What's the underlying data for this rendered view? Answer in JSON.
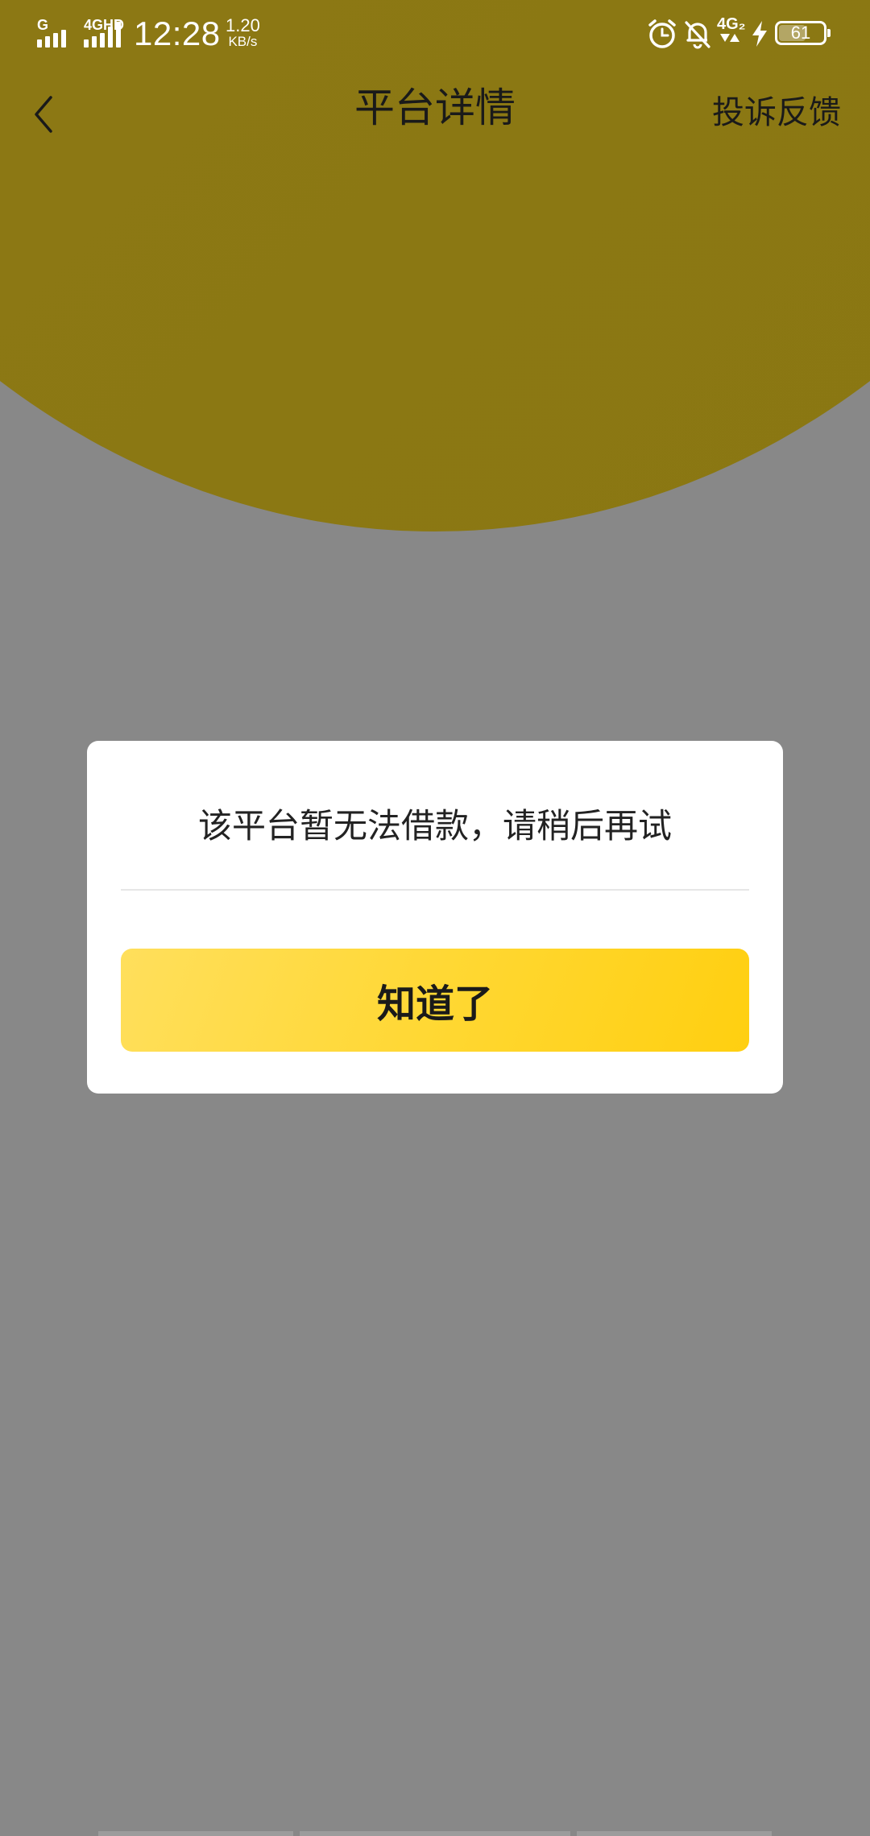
{
  "status_bar": {
    "signal1_tag": "G",
    "signal2_tag": "4GHD",
    "time": "12:28",
    "net_speed_value": "1.20",
    "net_speed_unit": "KB/s",
    "network2_label": "4G₂",
    "battery_level": "61",
    "battery_fraction": 0.61,
    "icons": [
      "signal-icon",
      "signal-icon",
      "alarm-icon",
      "bell-off-icon",
      "charging-bolt-icon",
      "battery-icon"
    ]
  },
  "navbar": {
    "title": "平台详情",
    "right_action": "投诉反馈",
    "back_icon": "chevron-left-icon"
  },
  "dialog": {
    "message": "该平台暂无法借款，请稍后再试",
    "confirm_label": "知道了"
  },
  "colors": {
    "header_bg": "#8c7814",
    "overlay_bg": "#888888",
    "dialog_bg": "#ffffff",
    "button_gradient_start": "#ffdf5c",
    "button_gradient_end": "#ffcf10",
    "text_primary": "#1a1a1a"
  }
}
